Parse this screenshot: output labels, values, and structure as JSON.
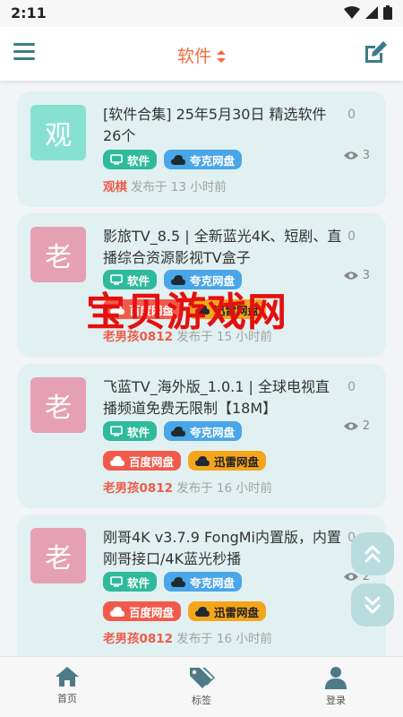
{
  "status_bar": {
    "time": "2:11"
  },
  "app_bar": {
    "title": "软件",
    "menu_icon": "hamburger-menu-icon",
    "edit_icon": "edit-icon"
  },
  "colors": {
    "accent": "#f26b3c",
    "card_bg": "#e1f0f0",
    "author": "#ef5b4a"
  },
  "posts": [
    {
      "avatar": "观",
      "title": "[软件合集] 25年5月30日 精选软件26个",
      "comments": "0",
      "views": "3",
      "tags": [
        "软件",
        "夸克网盘"
      ],
      "author": "观棋",
      "posted": "发布于 13 小时前"
    },
    {
      "avatar": "老",
      "title": "影旅TV_8.5 | 全新蓝光4K、短剧、直播综合资源影视TV盒子",
      "comments": "0",
      "views": "3",
      "tags": [
        "软件",
        "夸克网盘",
        "百度网盘",
        "迅雷网盘"
      ],
      "author": "老男孩0812",
      "posted": "发布于 15 小时前"
    },
    {
      "avatar": "老",
      "title": "飞蓝TV_海外版_1.0.1 | 全球电视直播频道免费无限制【18M】",
      "comments": "0",
      "views": "2",
      "tags": [
        "软件",
        "夸克网盘",
        "百度网盘",
        "迅雷网盘"
      ],
      "author": "老男孩0812",
      "posted": "发布于 16 小时前"
    },
    {
      "avatar": "老",
      "title": "刚哥4K v3.7.9 FongMi内置版，内置刚哥接口/4K蓝光秒播",
      "comments": "0",
      "views": "2",
      "tags": [
        "软件",
        "夸克网盘",
        "百度网盘",
        "迅雷网盘"
      ],
      "author": "老男孩0812",
      "posted": "发布于 16 小时前"
    }
  ],
  "watermark": "宝贝游戏网",
  "bottom_nav": [
    {
      "label": "首页",
      "icon": "home-icon"
    },
    {
      "label": "标签",
      "icon": "tags-icon"
    },
    {
      "label": "登录",
      "icon": "user-icon"
    }
  ]
}
